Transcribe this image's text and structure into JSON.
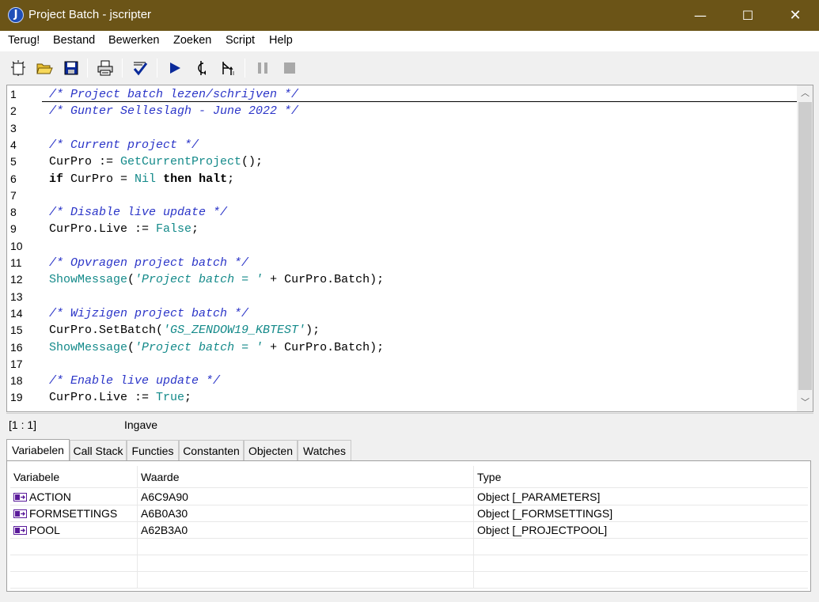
{
  "window": {
    "title": "Project Batch - jscripter",
    "app_icon_letter": "J",
    "controls": {
      "minimize": "—",
      "maximize": "☐",
      "close": "✕"
    },
    "titlebar_color": "#6b5417"
  },
  "menu": [
    "Terug!",
    "Bestand",
    "Bewerken",
    "Zoeken",
    "Script",
    "Help"
  ],
  "toolbar": {
    "buttons": [
      {
        "name": "new-icon",
        "enabled": true
      },
      {
        "name": "open-folder-icon",
        "enabled": true
      },
      {
        "name": "save-icon",
        "enabled": true
      },
      {
        "name": "print-icon",
        "enabled": true
      },
      {
        "name": "check-syntax-icon",
        "enabled": true
      },
      {
        "name": "run-icon",
        "enabled": true
      },
      {
        "name": "step-into-icon",
        "enabled": true
      },
      {
        "name": "step-over-icon",
        "enabled": true
      },
      {
        "name": "pause-icon",
        "enabled": false
      },
      {
        "name": "stop-icon",
        "enabled": false
      }
    ]
  },
  "editor": {
    "line_numbers": [
      "1",
      "2",
      "3",
      "4",
      "5",
      "6",
      "7",
      "8",
      "9",
      "10",
      "11",
      "12",
      "13",
      "14",
      "15",
      "16",
      "17",
      "18",
      "19"
    ],
    "lines": [
      [
        {
          "t": "comment",
          "s": "/* Project batch lezen/schrijven */"
        }
      ],
      [
        {
          "t": "comment",
          "s": "/* Gunter Selleslagh - June 2022 */"
        }
      ],
      [],
      [
        {
          "t": "comment",
          "s": "/* Current project */"
        }
      ],
      [
        {
          "t": "plain",
          "s": "CurPro := "
        },
        {
          "t": "func",
          "s": "GetCurrentProject"
        },
        {
          "t": "plain",
          "s": "();"
        }
      ],
      [
        {
          "t": "kw",
          "s": "if"
        },
        {
          "t": "plain",
          "s": " CurPro = "
        },
        {
          "t": "const",
          "s": "Nil"
        },
        {
          "t": "plain",
          "s": " "
        },
        {
          "t": "kw",
          "s": "then"
        },
        {
          "t": "plain",
          "s": " "
        },
        {
          "t": "kw",
          "s": "halt"
        },
        {
          "t": "plain",
          "s": ";"
        }
      ],
      [],
      [
        {
          "t": "comment",
          "s": "/* Disable live update */"
        }
      ],
      [
        {
          "t": "plain",
          "s": "CurPro.Live := "
        },
        {
          "t": "const",
          "s": "False"
        },
        {
          "t": "plain",
          "s": ";"
        }
      ],
      [],
      [
        {
          "t": "comment",
          "s": "/* Opvragen project batch */"
        }
      ],
      [
        {
          "t": "func",
          "s": "ShowMessage"
        },
        {
          "t": "plain",
          "s": "("
        },
        {
          "t": "str",
          "s": "'Project batch = '"
        },
        {
          "t": "plain",
          "s": " + CurPro.Batch);"
        }
      ],
      [],
      [
        {
          "t": "comment",
          "s": "/* Wijzigen project batch */"
        }
      ],
      [
        {
          "t": "plain",
          "s": "CurPro.SetBatch("
        },
        {
          "t": "str",
          "s": "'GS_ZENDOW19_KBTEST'"
        },
        {
          "t": "plain",
          "s": ");"
        }
      ],
      [
        {
          "t": "func",
          "s": "ShowMessage"
        },
        {
          "t": "plain",
          "s": "("
        },
        {
          "t": "str",
          "s": "'Project batch = '"
        },
        {
          "t": "plain",
          "s": " + CurPro.Batch);"
        }
      ],
      [],
      [
        {
          "t": "comment",
          "s": "/* Enable live update */"
        }
      ],
      [
        {
          "t": "plain",
          "s": "CurPro.Live := "
        },
        {
          "t": "const",
          "s": "True"
        },
        {
          "t": "plain",
          "s": ";"
        }
      ]
    ]
  },
  "status": {
    "position": "[1 : 1]",
    "mode": "Ingave"
  },
  "tabs": [
    {
      "label": "Variabelen",
      "active": true
    },
    {
      "label": "Call Stack",
      "active": false
    },
    {
      "label": "Functies",
      "active": false
    },
    {
      "label": "Constanten",
      "active": false
    },
    {
      "label": "Objecten",
      "active": false
    },
    {
      "label": "Watches",
      "active": false
    }
  ],
  "variables": {
    "columns": [
      "Variabele",
      "Waarde",
      "Type"
    ],
    "rows": [
      {
        "name": "ACTION",
        "value": "A6C9A90",
        "type": "Object [_PARAMETERS]"
      },
      {
        "name": "FORMSETTINGS",
        "value": "A6B0A30",
        "type": "Object [_FORMSETTINGS]"
      },
      {
        "name": "POOL",
        "value": "A62B3A0",
        "type": "Object [_PROJECTPOOL]"
      }
    ],
    "empty_rows": 3
  }
}
